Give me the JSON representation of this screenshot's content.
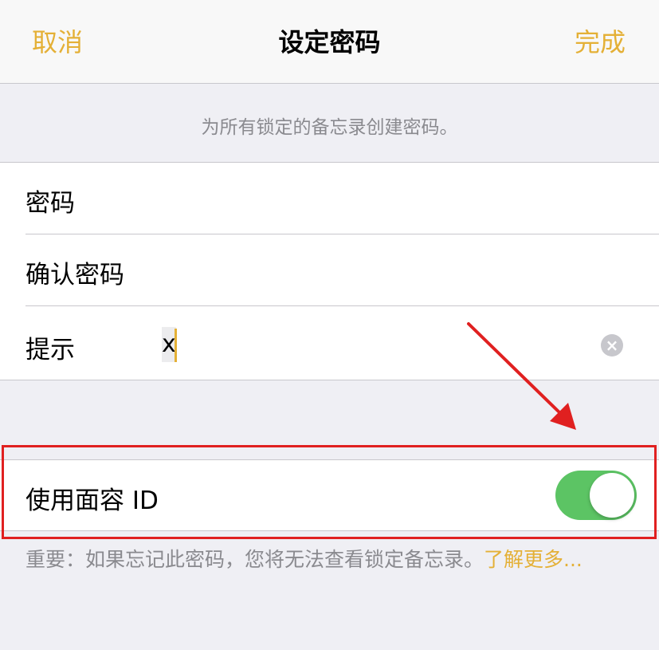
{
  "navbar": {
    "cancel_label": "取消",
    "title": "设定密码",
    "done_label": "完成"
  },
  "description": "为所有锁定的备忘录创建密码。",
  "form": {
    "password_label": "密码",
    "confirm_label": "确认密码",
    "hint_label": "提示",
    "hint_value": "x"
  },
  "faceid": {
    "label": "使用面容 ID",
    "enabled": true
  },
  "footer": {
    "text": "重要：如果忘记此密码，您将无法查看锁定备忘录。",
    "link": "了解更多..."
  },
  "colors": {
    "accent": "#e4b036",
    "toggle_on": "#5cc464",
    "annotation_red": "#e02020"
  }
}
